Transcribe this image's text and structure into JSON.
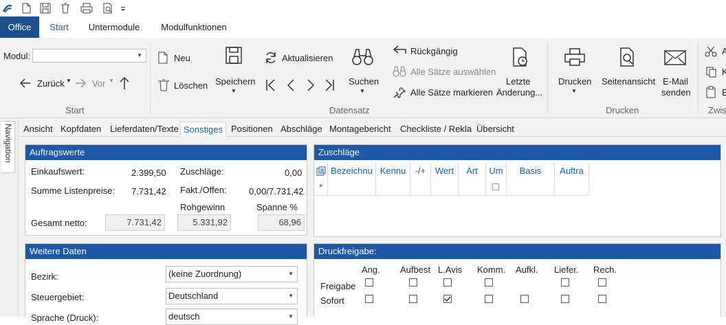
{
  "qat": {
    "icons": [
      "app-logo-icon",
      "new-document-icon",
      "save-icon",
      "delete-icon",
      "print-icon",
      "print-preview-icon",
      "customize-qat-icon"
    ]
  },
  "menu": {
    "tabs": [
      "Office",
      "Start",
      "Untermodule",
      "Modulfunktionen"
    ]
  },
  "ribbon": {
    "modul_label": "Modul:",
    "modul_value": "",
    "back": "Zurück",
    "forward": "Vor",
    "group_start": "Start",
    "neu": "Neu",
    "loeschen": "Löschen",
    "speichern": "Speichern",
    "aktualisieren": "Aktualisieren",
    "suchen": "Suchen",
    "rueckgaengig": "Rückgängig",
    "alle_auswaehlen": "Alle Sätze auswählen",
    "alle_markieren": "Alle Sätze markieren",
    "letzte_1": "Letzte",
    "letzte_2": "Änderung...",
    "group_datensatz": "Datensatz",
    "drucken": "Drucken",
    "seitenansicht": "Seitenansicht",
    "email_1": "E-Mail",
    "email_2": "senden",
    "group_drucken": "Drucken",
    "extra_a": "A",
    "extra_k": "K",
    "extra_b": "B",
    "group_zwis": "Zwis"
  },
  "nav": {
    "label": "Navigation"
  },
  "tabs": [
    "Ansicht",
    "Kopfdaten",
    "Lieferdaten/Texte",
    "Sonstiges",
    "Positionen",
    "Abschläge",
    "Montagebericht",
    "Checkliste / Rekla",
    "Übersicht"
  ],
  "auftragswerte": {
    "title": "Auftragswerte",
    "einkaufswert_label": "Einkaufswert:",
    "einkaufswert": "2.399,50",
    "zuschlaege_label": "Zuschläge:",
    "zuschlaege": "0,00",
    "summe_label": "Summe Listenpreise:",
    "summe": "7.731,42",
    "fakt_label": "Fakt./Offen:",
    "fakt": "0,00/7.731,42",
    "rohgewinn_label": "Rohgewinn",
    "spanne_label": "Spanne %",
    "gesamt_label": "Gesamt netto:",
    "gesamt": "7.731,42",
    "rohgewinn": "5.331,92",
    "spanne": "68,96"
  },
  "zuschlaege_grid": {
    "title": "Zuschläge",
    "columns": [
      "Bezeichnu",
      "Kennu",
      "-/+",
      "Wert",
      "Art",
      "Um",
      "Basis",
      "Auftra"
    ],
    "new_row_marker": "*"
  },
  "weitere": {
    "title": "Weitere Daten",
    "bezirk_label": "Bezirk:",
    "bezirk": "(keine Zuordnung)",
    "steuer_label": "Steuergebiet:",
    "steuer": "Deutschland",
    "sprache_label": "Sprache (Druck):",
    "sprache": "deutsch"
  },
  "druckfreigabe": {
    "title": "Druckfreigabe:",
    "columns": [
      "Ang.",
      "Aufbest",
      "L.Avis",
      "Komm.",
      "Aufkl.",
      "Liefer.",
      "Rech."
    ],
    "rows": [
      {
        "label": "Freigabe",
        "checked": [
          false,
          false,
          false,
          false,
          null,
          false,
          false
        ]
      },
      {
        "label": "Sofort",
        "checked": [
          false,
          false,
          true,
          false,
          false,
          false,
          false
        ]
      }
    ]
  },
  "colors": {
    "accent": "#1d59a9",
    "office_tab": "#1e4e8c"
  }
}
